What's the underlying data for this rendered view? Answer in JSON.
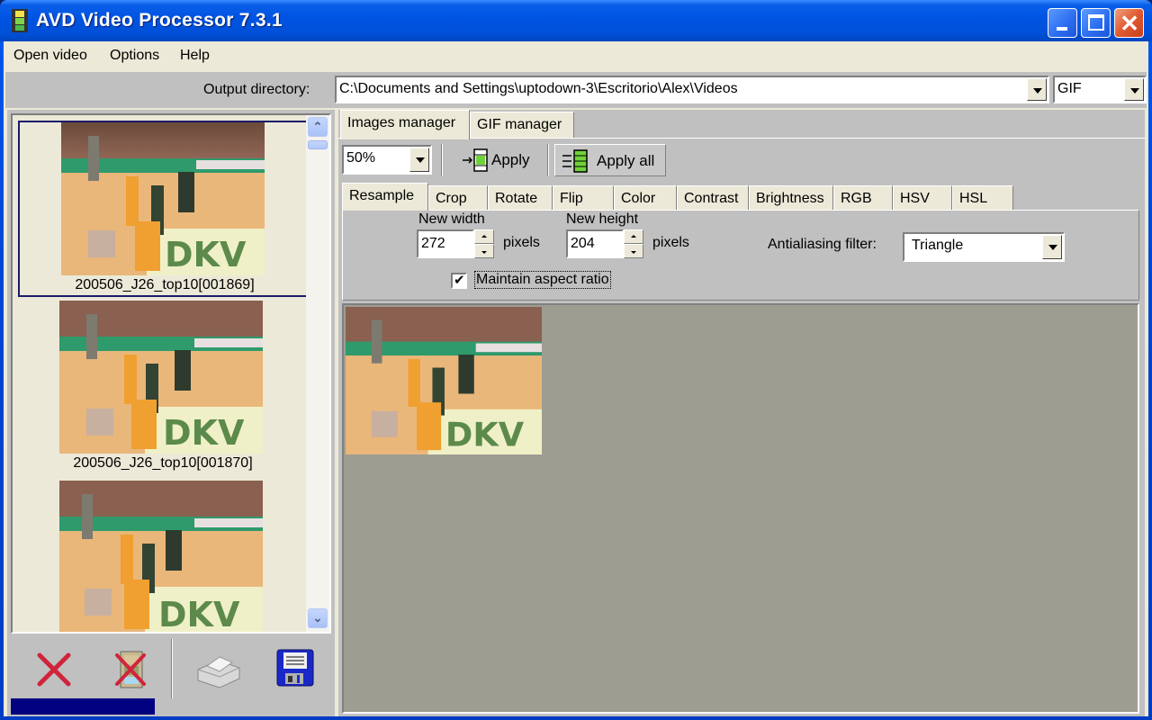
{
  "window": {
    "title": "AVD Video Processor 7.3.1",
    "controls": {
      "minimize": "minimize",
      "maximize": "maximize",
      "close": "✕"
    }
  },
  "menu": [
    "Open video",
    "Options",
    "Help"
  ],
  "output": {
    "label": "Output directory:",
    "directory": "C:\\Documents and Settings\\uptodown-3\\Escritorio\\Alex\\Videos",
    "format": "GIF"
  },
  "thumbnails": [
    {
      "caption": "200506_J26_top10[001869]",
      "selected": true
    },
    {
      "caption": "200506_J26_top10[001870]",
      "selected": false
    },
    {
      "caption": "",
      "selected": false
    }
  ],
  "bottom_tools": [
    {
      "name": "delete-icon"
    },
    {
      "name": "delete-frames-icon"
    },
    {
      "name": "printer-icon"
    },
    {
      "name": "save-icon"
    }
  ],
  "progress": {
    "fraction": 0.45
  },
  "main_tabs": [
    {
      "label": "Images manager",
      "active": true
    },
    {
      "label": "GIF manager",
      "active": false
    }
  ],
  "toolbar": {
    "zoom": "50%",
    "apply": "Apply",
    "apply_all": "Apply all"
  },
  "sub_tabs": [
    {
      "label": "Resample",
      "active": true
    },
    {
      "label": "Crop"
    },
    {
      "label": "Rotate"
    },
    {
      "label": "Flip"
    },
    {
      "label": "Color"
    },
    {
      "label": "Contrast"
    },
    {
      "label": "Brightness"
    },
    {
      "label": "RGB"
    },
    {
      "label": "HSV"
    },
    {
      "label": "HSL"
    }
  ],
  "resample": {
    "width_label": "New width",
    "width_value": "272",
    "height_label": "New height",
    "height_value": "204",
    "unit": "pixels",
    "aspect_label": "Maintain aspect ratio",
    "aspect_checked": true,
    "filter_label": "Antialiasing filter:",
    "filter_value": "Triangle"
  },
  "colors": {
    "titlebar": "#0054e3",
    "panel": "#c0c0c0",
    "preview_bg": "#9d9d91",
    "progress": "#000080"
  }
}
